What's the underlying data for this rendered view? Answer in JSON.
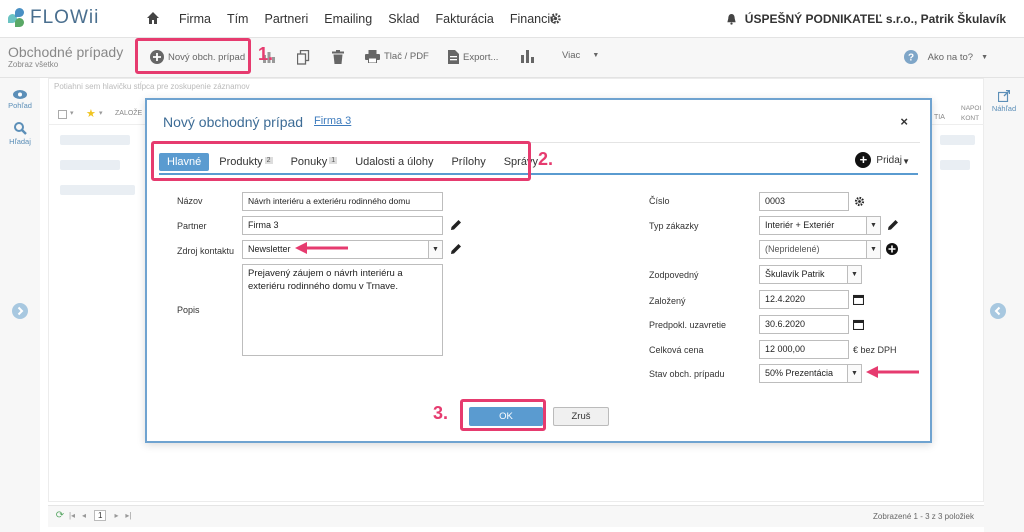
{
  "app": {
    "logo": "FLOWii"
  },
  "nav": {
    "items": [
      "Firma",
      "Tím",
      "Partneri",
      "Emailing",
      "Sklad",
      "Fakturácia",
      "Financie"
    ],
    "company": "ÚSPEŠNÝ PODNIKATEĽ s.r.o., Patrik Škulavík"
  },
  "toolbar": {
    "title": "Obchodné prípady",
    "subtitle": "Zobraz všetko",
    "new_label": "Nový obch. prípad",
    "print_label": "Tlač / PDF",
    "export_label": "Export...",
    "more_label": "Viac",
    "help_label": "Ako na to?"
  },
  "rails": {
    "view_label": "Pohľad",
    "search_label": "Hľadaj",
    "preview_label": "Náhľad"
  },
  "grid": {
    "hint": "Potiahni sem hlavičku stĺpca pre zoskupenie záznamov",
    "col_created": "ZALOŽE",
    "col_right1": "TIA",
    "col_right2a": "NAPOI",
    "col_right2b": "KONT",
    "footer_info": "Zobrazené 1 - 3 z 3 položiek",
    "page": "1"
  },
  "dialog": {
    "title": "Nový obchodný prípad",
    "firm_link": "Firma 3",
    "close": "×",
    "tabs": [
      {
        "label": "Hlavné",
        "badge": ""
      },
      {
        "label": "Produkty",
        "badge": "2"
      },
      {
        "label": "Ponuky",
        "badge": "1"
      },
      {
        "label": "Udalosti a úlohy",
        "badge": ""
      },
      {
        "label": "Prílohy",
        "badge": ""
      },
      {
        "label": "Správy",
        "badge": ""
      }
    ],
    "add_label": "Pridaj",
    "left": {
      "name_label": "Názov",
      "name_value": "Návrh interiéru a exteriéru rodinného domu",
      "partner_label": "Partner",
      "partner_value": "Firma 3",
      "source_label": "Zdroj kontaktu",
      "source_value": "Newsletter",
      "desc_label": "Popis",
      "desc_value": "Prejavený záujem o návrh interiéru a exteriéru rodinného domu v Trnave."
    },
    "right": {
      "number_label": "Číslo",
      "number_value": "0003",
      "type_label": "Typ zákazky",
      "type_value": "Interiér + Exteriér",
      "type2_value": "(Nepridelené)",
      "owner_label": "Zodpovedný",
      "owner_value": "Škulavík Patrik",
      "created_label": "Založený",
      "created_value": "12.4.2020",
      "close_label": "Predpokl. uzavretie",
      "close_value": "30.6.2020",
      "price_label": "Celková cena",
      "price_value": "12 000,00",
      "price_unit": "€  bez DPH",
      "state_label": "Stav obch. prípadu",
      "state_value": "50% Prezentácia"
    },
    "ok_label": "OK",
    "cancel_label": "Zruš"
  },
  "annotations": {
    "n1": "1.",
    "n2": "2.",
    "n3": "3.",
    "color": "#e63b6f"
  }
}
